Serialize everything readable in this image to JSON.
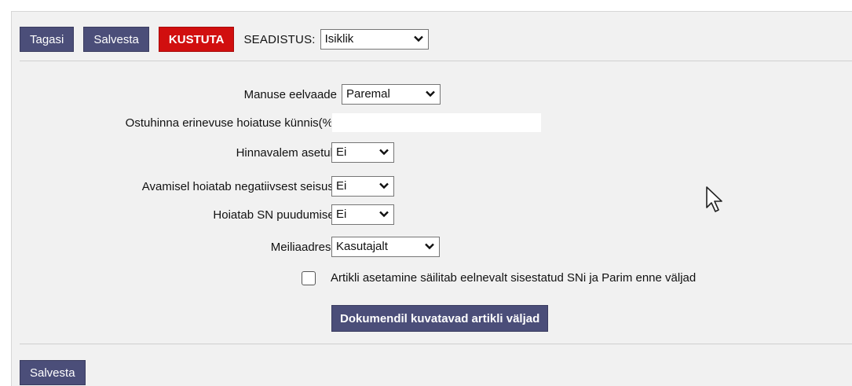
{
  "toolbar": {
    "back_label": "Tagasi",
    "save_label": "Salvesta",
    "delete_label": "KUSTUTA",
    "setup_label": "SEADISTUS:",
    "setup_value": "Isiklik"
  },
  "form": {
    "attachment_preview": {
      "label": "Manuse eelvaade",
      "value": "Paremal"
    },
    "price_diff_threshold": {
      "label": "Ostuhinna erinevuse hoiatuse künnis(%)",
      "value": ""
    },
    "price_formula": {
      "label": "Hinnavalem asetub",
      "value": "Ei"
    },
    "negative_stock_warning": {
      "label": "Avamisel hoiatab negatiivsest seisust",
      "value": "Ei"
    },
    "missing_sn_warning": {
      "label": "Hoiatab SN puudumisel",
      "value": "Ei"
    },
    "email_address": {
      "label": "Meiliaadress",
      "value": "Kasutajalt"
    },
    "keep_sn_checkbox": {
      "label": "Artikli asetamine säilitab eelnevalt sisestatud SNi ja Parim enne väljad",
      "checked": false
    },
    "document_fields_button": "Dokumendil kuvatavad artikli väljad"
  },
  "footer": {
    "save_label": "Salvesta"
  },
  "icons": {
    "dropdown": "chevron-down-icon",
    "cursor": "mouse-pointer-icon"
  },
  "colors": {
    "button": "#4b4e79",
    "danger_button": "#d10f0f",
    "panel_background": "#f1f1f1"
  }
}
